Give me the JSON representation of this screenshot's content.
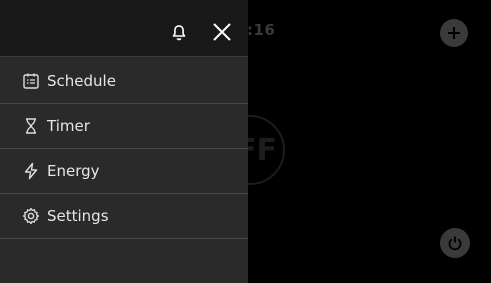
{
  "background": {
    "clock_fragment": ":16",
    "state_fragment": "FF"
  },
  "drawer": {
    "items": [
      {
        "label": "Schedule",
        "icon": "schedule-icon"
      },
      {
        "label": "Timer",
        "icon": "hourglass-icon"
      },
      {
        "label": "Energy",
        "icon": "lightning-icon"
      },
      {
        "label": "Settings",
        "icon": "gear-icon"
      }
    ]
  },
  "colors": {
    "drawer_bg": "#2a2a2a",
    "header_bg": "#191919",
    "divider": "#4a4a4a",
    "screen_bg": "#000000"
  }
}
